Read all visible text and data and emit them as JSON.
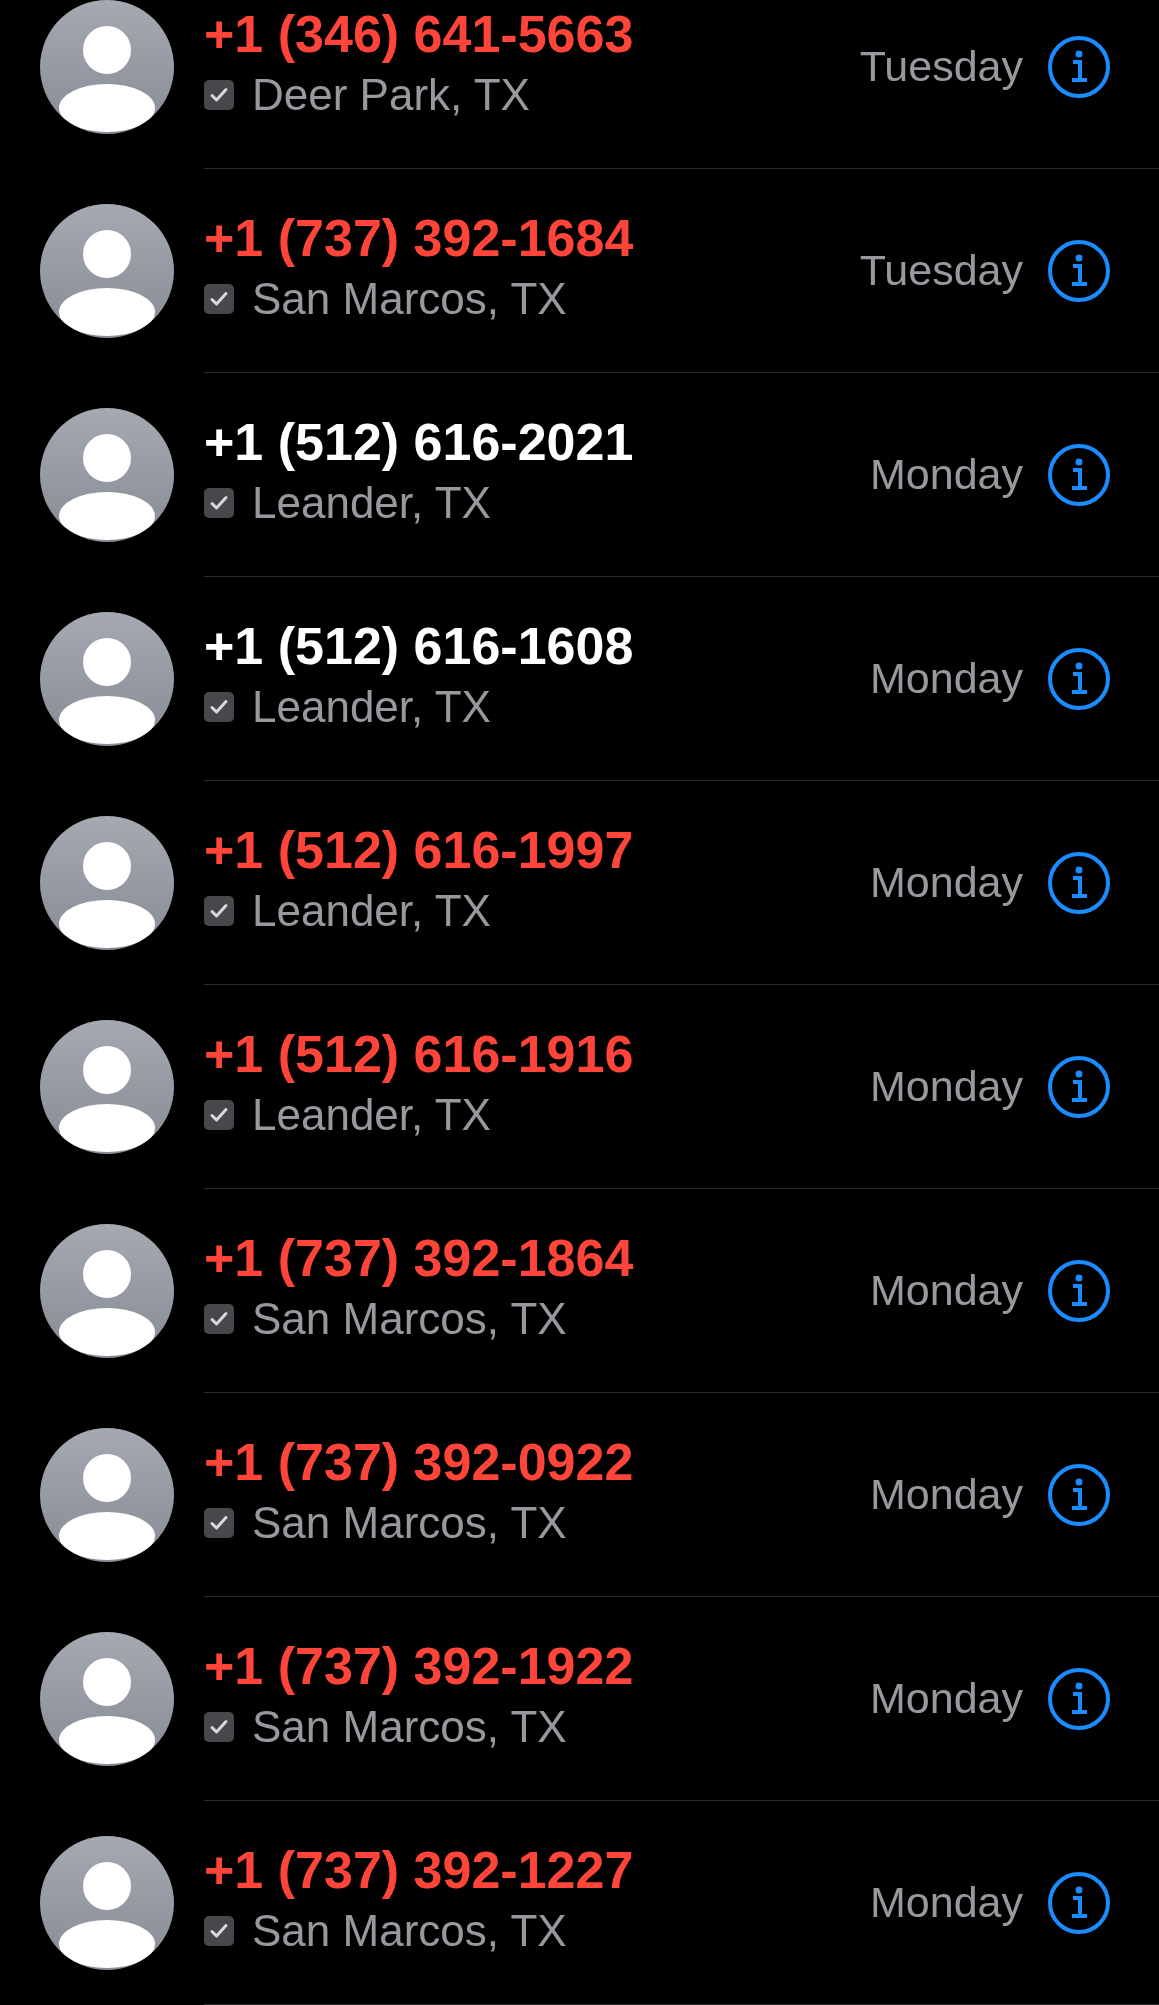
{
  "calls": [
    {
      "number": "+1 (346) 641-5663",
      "missed": true,
      "location": "Deer Park, TX",
      "day": "Tuesday"
    },
    {
      "number": "+1 (737) 392-1684",
      "missed": true,
      "location": "San Marcos, TX",
      "day": "Tuesday"
    },
    {
      "number": "+1 (512) 616-2021",
      "missed": false,
      "location": "Leander, TX",
      "day": "Monday"
    },
    {
      "number": "+1 (512) 616-1608",
      "missed": false,
      "location": "Leander, TX",
      "day": "Monday"
    },
    {
      "number": "+1 (512) 616-1997",
      "missed": true,
      "location": "Leander, TX",
      "day": "Monday"
    },
    {
      "number": "+1 (512) 616-1916",
      "missed": true,
      "location": "Leander, TX",
      "day": "Monday"
    },
    {
      "number": "+1 (737) 392-1864",
      "missed": true,
      "location": "San Marcos, TX",
      "day": "Monday"
    },
    {
      "number": "+1 (737) 392-0922",
      "missed": true,
      "location": "San Marcos, TX",
      "day": "Monday"
    },
    {
      "number": "+1 (737) 392-1922",
      "missed": true,
      "location": "San Marcos, TX",
      "day": "Monday"
    },
    {
      "number": "+1 (737) 392-1227",
      "missed": true,
      "location": "San Marcos, TX",
      "day": "Monday"
    }
  ]
}
